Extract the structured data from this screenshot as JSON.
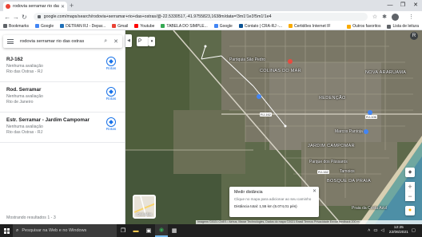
{
  "browser": {
    "tab_title": "rodovia serramar rio das ostras",
    "new_tab": "+",
    "url": "google.com/maps/search/rodovia+serramar+rio+das+ostras/@-22.5330517,-41.9755823,1638m/data=!3m1!1e3!5m1!1e4",
    "avatar_letter": "R",
    "window_controls": [
      "—",
      "❐",
      "✕"
    ]
  },
  "bookmarks": {
    "items": [
      "Bookmarks",
      "Google",
      "DETRAN RJ - Depar...",
      "Gmail",
      "Youtube",
      "TABELA DO SIMPLE...",
      "Google",
      "Contato | CRA-RJ -...",
      "Certidões Internet IF"
    ],
    "others": "Outros favoritos",
    "reading": "Lista de leitura"
  },
  "search": {
    "query": "rodovia serramar rio das ostras"
  },
  "results": [
    {
      "name": "RJ-162",
      "rating": "Nenhuma avaliação",
      "place": "Rio das Ostras - RJ",
      "action": "Rotas"
    },
    {
      "name": "Rod. Serramar",
      "rating": "Nenhuma avaliação",
      "place": "Rio de Janeiro",
      "action": "Rotas"
    },
    {
      "name": "Estr. Serramar - Jardim Campomar",
      "rating": "Nenhuma avaliação",
      "place": "Rio das Ostras - RJ",
      "action": "Rotas"
    }
  ],
  "results_footer": "Mostrando resultados 1 - 3",
  "map": {
    "chip_label": "P",
    "labels": [
      "Paróquia São Pedro",
      "COLINAS DO MAR",
      "NOVA ARARUAMA",
      "REDENÇÃO",
      "JARDIM CAMPOMAR",
      "Marcos Pantoja",
      "Parque dos Pássaros",
      "Tamoios",
      "BOSQUE DA PRAIA",
      "Praia da Costa Azul"
    ],
    "road_badges": [
      "RJ-162",
      "RJ-106",
      "RJ-162"
    ],
    "layer_label": "Camadas",
    "account_letter": "R"
  },
  "measure": {
    "title": "Medir distância",
    "hint": "Clique no mapa para adicionar ao seu caminho",
    "distance": "Distância total: 1,55 km (5.074,01 pés)"
  },
  "attribution": "Imagens ©2021 CNES / Airbus, Maxar Technologies, Dados do mapa ©2021   Brasil   Termos   Privacidade   Enviar feedback   200 m",
  "taskbar": {
    "search_placeholder": "Pesquisar na Web e no Windows",
    "time": "12:25",
    "date": "22/06/2021"
  }
}
